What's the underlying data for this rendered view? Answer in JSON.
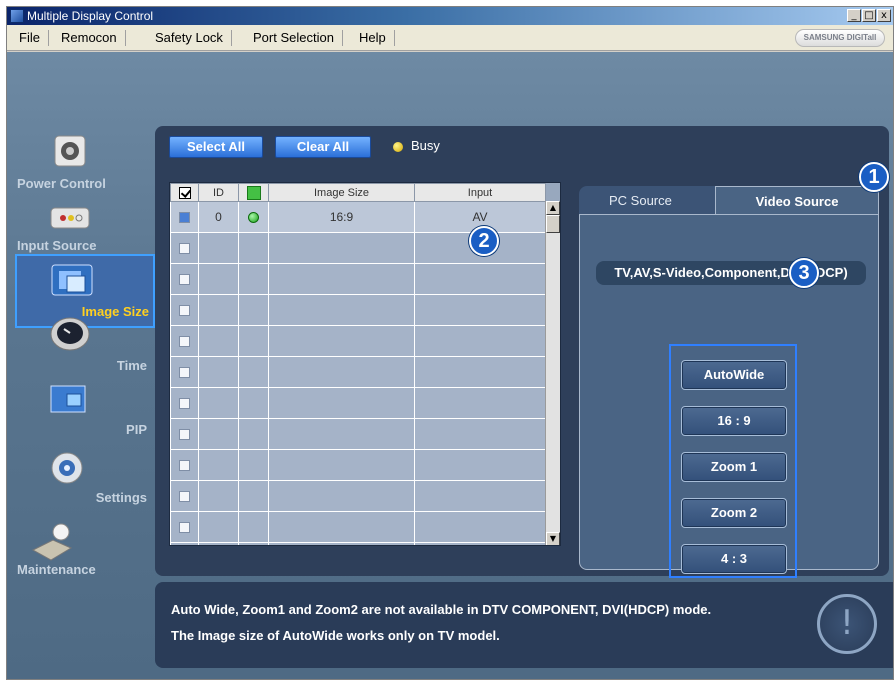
{
  "window": {
    "title": "Multiple Display Control",
    "controls": [
      "_",
      "□",
      "x"
    ]
  },
  "menu": {
    "items": [
      "File",
      "Remocon",
      "Safety Lock",
      "Port Selection",
      "Help"
    ],
    "brand": "SAMSUNG DIGITall"
  },
  "sidebar": {
    "items": [
      {
        "label": "Power Control",
        "icon": "power-control-icon",
        "active": false
      },
      {
        "label": "Input Source",
        "icon": "input-source-icon",
        "active": false
      },
      {
        "label": "Image Size",
        "icon": "image-size-icon",
        "active": true
      },
      {
        "label": "Time",
        "icon": "clock-icon",
        "active": false
      },
      {
        "label": "PIP",
        "icon": "pip-icon",
        "active": false
      },
      {
        "label": "Settings",
        "icon": "settings-icon",
        "active": false
      },
      {
        "label": "Maintenance",
        "icon": "maintenance-icon",
        "active": false
      }
    ]
  },
  "toolbar": {
    "select_all": "Select All",
    "clear_all": "Clear All",
    "busy_label": "Busy"
  },
  "grid": {
    "columns": [
      "",
      "ID",
      "",
      "Image Size",
      "Input"
    ],
    "rows": [
      {
        "id": "0",
        "image_size": "16:9",
        "input": "AV",
        "checked": true,
        "online": true
      }
    ],
    "empty_rows": 11
  },
  "source": {
    "tabs": [
      "PC Source",
      "Video Source"
    ],
    "active_tab": "Video Source",
    "modes": "TV,AV,S-Video,Component,DVI(HDCP)",
    "size_buttons": [
      "AutoWide",
      "16 : 9",
      "Zoom 1",
      "Zoom 2",
      "4 : 3"
    ]
  },
  "markers": [
    "1",
    "2",
    "3"
  ],
  "info": {
    "line1": "Auto Wide, Zoom1 and Zoom2 are not available in DTV COMPONENT, DVI(HDCP) mode.",
    "line2": "The Image size of AutoWide works only on TV model.",
    "icon": "exclamation-icon"
  },
  "colors": {
    "panel": "#2e3f5a",
    "accent": "#2f7fff",
    "active_label": "#ffd020",
    "button_blue": "#2b6fd8"
  }
}
